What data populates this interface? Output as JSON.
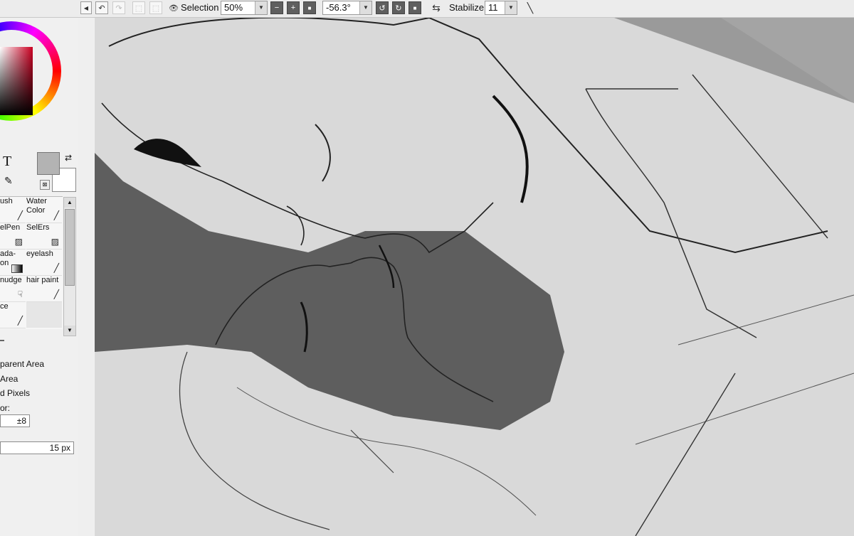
{
  "toolbar": {
    "selection_label": "Selection",
    "zoom_value": "50%",
    "rotation_value": "-56.3°",
    "stabilizer_label": "Stabilizer",
    "stabilizer_value": "11"
  },
  "colors": {
    "primary": "#b3b3b3",
    "secondary": "#ffffff",
    "hue_square_color": "#cc0022"
  },
  "brushes": [
    {
      "label": "ush",
      "icon": "brush-icon"
    },
    {
      "label": "Water Color",
      "icon": "water-brush-icon"
    },
    {
      "label": "elPen",
      "icon": "selpen-icon"
    },
    {
      "label": "SelErs",
      "icon": "selers-icon"
    },
    {
      "label": "ada- on",
      "icon": "gradation-icon"
    },
    {
      "label": "eyelash",
      "icon": "pen-icon"
    },
    {
      "label": "nudge",
      "icon": "smudge-icon"
    },
    {
      "label": "hair paint",
      "icon": "pen-icon"
    },
    {
      "label": "ce",
      "icon": "pen-icon"
    }
  ],
  "options": {
    "line1": "parent Area",
    "line2": "Area",
    "line3": "d Pixels",
    "line4": "or:",
    "tolerance_value": "±8",
    "size_value": "15 px"
  }
}
